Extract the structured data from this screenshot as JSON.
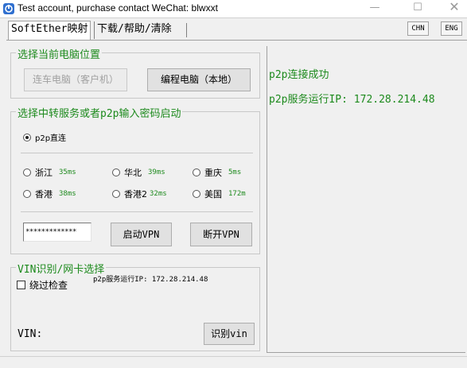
{
  "window": {
    "title": "Test account, purchase contact WeChat: blwxxt"
  },
  "controls": {
    "minimize": "—",
    "maximize": "☐",
    "close": "✕"
  },
  "tabs": [
    {
      "label": "SoftEther映射"
    },
    {
      "label": "下载/帮助/清除"
    }
  ],
  "lang_buttons": {
    "chn": "CHN",
    "eng": "ENG"
  },
  "location_group": {
    "label": "选择当前电脑位置",
    "client_button": "连车电脑（客户机）",
    "host_button": "编程电脑（本地）"
  },
  "mode_group": {
    "label": "选择中转服务或者p2p输入密码启动",
    "p2p_label": "p2p直连",
    "servers": [
      {
        "name": "浙江",
        "ping": "35ms"
      },
      {
        "name": "华北",
        "ping": "39ms"
      },
      {
        "name": "重庆",
        "ping": "5ms"
      },
      {
        "name": "香港",
        "ping": "38ms"
      },
      {
        "name": "香港2",
        "ping": "32ms"
      },
      {
        "name": "美国",
        "ping": "172m"
      }
    ],
    "password": "*************",
    "start_button": "启动VPN",
    "stop_button": "断开VPN"
  },
  "vin_group": {
    "label": "VIN识别/网卡选择",
    "skip_check_label": "绕过检查",
    "ip_text": "p2p服务运行IP: 172.28.214.48",
    "vin_label": "VIN:",
    "vin_button": "识别vin"
  },
  "status": {
    "line1": "p2p连接成功",
    "line2": "p2p服务运行IP: 172.28.214.48"
  },
  "colors": {
    "accent_green": "#1d8a1d",
    "app_icon_blue": "#2f6fcf"
  }
}
